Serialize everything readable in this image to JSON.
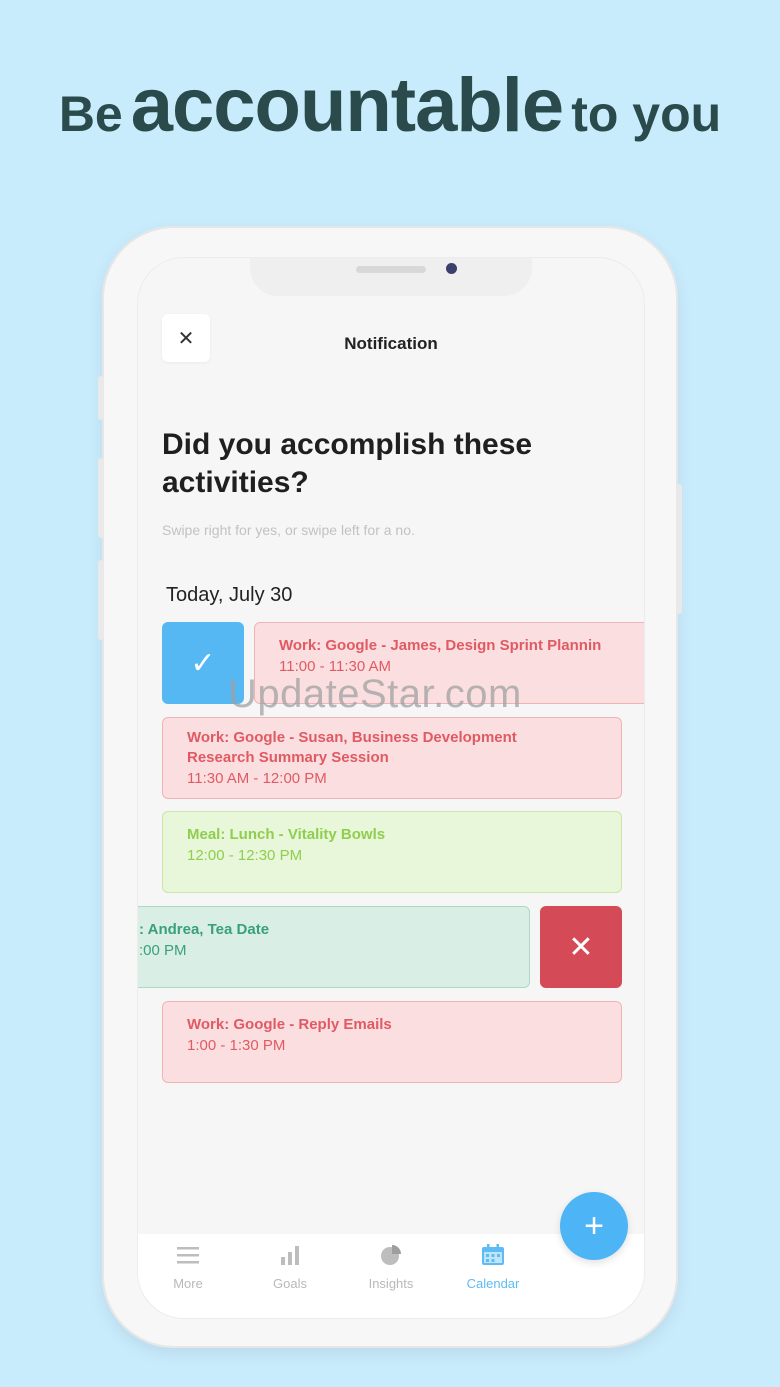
{
  "headline": {
    "part1": "Be",
    "part2": "accountable",
    "part3": "to you"
  },
  "header": {
    "close_symbol": "✕",
    "title": "Notification"
  },
  "prompt": {
    "question": "Did you accomplish these activities?",
    "hint": "Swipe right for yes, or swipe left for a no."
  },
  "date_label": "Today, July 30",
  "activities": [
    {
      "title": "Work: Google - James, Design Sprint Plannin",
      "time": "11:00 - 11:30 AM",
      "category": "work"
    },
    {
      "title": "Work: Google - Susan, Business Development Research Summary Session",
      "time": "11:30 AM - 12:00 PM",
      "category": "work"
    },
    {
      "title": "Meal: Lunch - Vitality Bowls",
      "time": "12:00 - 12:30 PM",
      "category": "meal"
    },
    {
      "title": ": Andrea, Tea Date",
      "time": ":00 PM",
      "category": "social"
    },
    {
      "title": "Work: Google - Reply Emails",
      "time": "1:00 - 1:30 PM",
      "category": "work"
    }
  ],
  "actions": {
    "yes_symbol": "✓",
    "no_symbol": "✕"
  },
  "tabs": [
    {
      "label": "More",
      "icon": "menu-icon"
    },
    {
      "label": "Goals",
      "icon": "bar-chart-icon"
    },
    {
      "label": "Insights",
      "icon": "pie-chart-icon"
    },
    {
      "label": "Calendar",
      "icon": "calendar-icon",
      "active": true
    }
  ],
  "fab_symbol": "+",
  "watermark": "UpdateStar.com",
  "colors": {
    "background": "#c9ecfd",
    "accent": "#4db5f5",
    "work": "#e05a63",
    "meal": "#8fce4e",
    "social": "#3aa07a",
    "reject": "#d44b57"
  }
}
